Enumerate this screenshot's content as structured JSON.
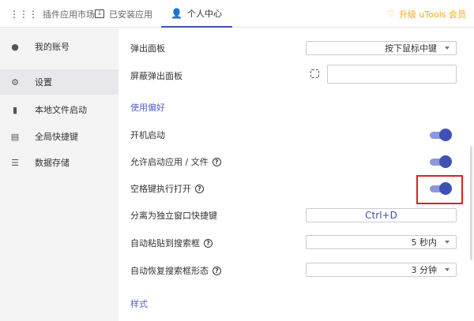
{
  "tabs": [
    {
      "label": "插件应用市场",
      "icon": "grid-icon"
    },
    {
      "label": "已安装应用",
      "icon": "download-monitor-icon"
    },
    {
      "label": "个人中心",
      "icon": "user-gear-icon",
      "active": true
    }
  ],
  "upgrade_label": "升级 uTools 会员",
  "sidebar": [
    {
      "label": "我的账号",
      "icon": "account-icon"
    },
    {
      "label": "设置",
      "icon": "gear-icon",
      "active": true
    },
    {
      "label": "本地文件启动",
      "icon": "file-icon"
    },
    {
      "label": "全局快捷键",
      "icon": "keyboard-icon"
    },
    {
      "label": "数据存储",
      "icon": "list-icon"
    }
  ],
  "settings": {
    "popup_panel": {
      "label": "弹出面板",
      "value": "按下鼠标中键"
    },
    "block_popup": {
      "label": "屏蔽弹出面板",
      "value": ""
    },
    "section_prefs": "使用偏好",
    "boot_start": {
      "label": "开机启动",
      "on": true
    },
    "allow_launch": {
      "label": "允许启动应用 / 文件",
      "on": true
    },
    "space_open": {
      "label": "空格键执行打开",
      "on": true
    },
    "detach_hotkey": {
      "label": "分离为独立窗口快捷键",
      "value": "Ctrl+D"
    },
    "auto_paste": {
      "label": "自动粘贴到搜索框",
      "value": "5 秒内"
    },
    "auto_restore": {
      "label": "自动恢复搜索框形态",
      "value": "3 分钟"
    },
    "section_style": "样式"
  },
  "colors": {
    "accent": "#3f51b5",
    "upgrade": "#f5a623",
    "highlight": "#e02020"
  }
}
